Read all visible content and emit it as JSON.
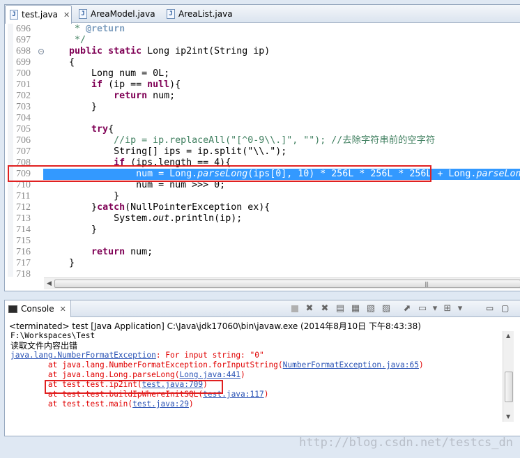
{
  "editor": {
    "tabs": [
      {
        "label": "test.java",
        "active": true,
        "close": "✕"
      },
      {
        "label": "AreaModel.java",
        "active": false
      },
      {
        "label": "AreaList.java",
        "active": false
      }
    ],
    "lines": [
      {
        "num": "696",
        "parts": [
          {
            "t": "     * ",
            "c": "cm"
          },
          {
            "t": "@return",
            "c": "ann"
          }
        ]
      },
      {
        "num": "697",
        "parts": [
          {
            "t": "     */",
            "c": "cm"
          }
        ]
      },
      {
        "num": "698",
        "fold": true,
        "parts": [
          {
            "t": "    "
          },
          {
            "t": "public static",
            "c": "kw"
          },
          {
            "t": " Long ip2int(String ip)"
          }
        ]
      },
      {
        "num": "699",
        "parts": [
          {
            "t": "    {"
          }
        ]
      },
      {
        "num": "700",
        "parts": [
          {
            "t": "        Long num = 0L;"
          }
        ]
      },
      {
        "num": "701",
        "parts": [
          {
            "t": "        "
          },
          {
            "t": "if",
            "c": "kw"
          },
          {
            "t": " (ip == "
          },
          {
            "t": "null",
            "c": "kw"
          },
          {
            "t": "){"
          }
        ]
      },
      {
        "num": "702",
        "parts": [
          {
            "t": "            "
          },
          {
            "t": "return",
            "c": "kw"
          },
          {
            "t": " num;"
          }
        ]
      },
      {
        "num": "703",
        "parts": [
          {
            "t": "        }"
          }
        ]
      },
      {
        "num": "704",
        "parts": []
      },
      {
        "num": "705",
        "parts": [
          {
            "t": "        "
          },
          {
            "t": "try",
            "c": "kw"
          },
          {
            "t": "{"
          }
        ]
      },
      {
        "num": "706",
        "parts": [
          {
            "t": "            //ip = ip.replaceAll(\"[^0-9\\\\.]\", \"\"); //去除字符串前的空字符",
            "c": "cm"
          }
        ]
      },
      {
        "num": "707",
        "parts": [
          {
            "t": "            String[] ips = ip.split(\"\\\\.\");"
          }
        ]
      },
      {
        "num": "708",
        "parts": [
          {
            "t": "            "
          },
          {
            "t": "if",
            "c": "kw"
          },
          {
            "t": " (ips.length == 4){"
          }
        ]
      },
      {
        "num": "709",
        "highlight": true,
        "parts": [
          {
            "t": "                num = Long."
          },
          {
            "t": "parseLong",
            "c": "it"
          },
          {
            "t": "(ips[0], 10) * 256L * 256L * 256L + Long."
          },
          {
            "t": "parseLong",
            "c": "it"
          }
        ]
      },
      {
        "num": "710",
        "parts": [
          {
            "t": "                num = num >>> 0;"
          }
        ]
      },
      {
        "num": "711",
        "parts": [
          {
            "t": "            }"
          }
        ]
      },
      {
        "num": "712",
        "parts": [
          {
            "t": "        }"
          },
          {
            "t": "catch",
            "c": "kw"
          },
          {
            "t": "(NullPointerException ex){"
          }
        ]
      },
      {
        "num": "713",
        "parts": [
          {
            "t": "            System."
          },
          {
            "t": "out",
            "c": "it"
          },
          {
            "t": ".println(ip);"
          }
        ]
      },
      {
        "num": "714",
        "parts": [
          {
            "t": "        }"
          }
        ]
      },
      {
        "num": "715",
        "parts": []
      },
      {
        "num": "716",
        "parts": [
          {
            "t": "        "
          },
          {
            "t": "return",
            "c": "kw"
          },
          {
            "t": " num;"
          }
        ]
      },
      {
        "num": "717",
        "parts": [
          {
            "t": "    }"
          }
        ]
      },
      {
        "num": "718",
        "parts": []
      }
    ],
    "hscroll_grip": "|||"
  },
  "console": {
    "tab_label": "Console",
    "tab_close": "✕",
    "terminated": "<terminated> test [Java Application] C:\\Java\\jdk17060\\bin\\javaw.exe (2014年8月10日 下午8:43:38)",
    "output": [
      {
        "cjk": false,
        "parts": [
          {
            "t": "F:\\Workspaces\\Test"
          }
        ]
      },
      {
        "cjk": true,
        "parts": [
          {
            "t": "读取文件内容出错"
          }
        ]
      },
      {
        "cjk": false,
        "parts": [
          {
            "t": "java.lang.NumberFormatException",
            "c": "lnk"
          },
          {
            "t": ": For input string: \"0\"",
            "c": "err"
          }
        ]
      },
      {
        "cjk": false,
        "parts": [
          {
            "t": "        at java.lang.NumberFormatException.forInputString(",
            "c": "err"
          },
          {
            "t": "NumberFormatException.java:65",
            "c": "lnk"
          },
          {
            "t": ")",
            "c": "err"
          }
        ]
      },
      {
        "cjk": false,
        "parts": [
          {
            "t": "        at java.lang.Long.parseLong(",
            "c": "err"
          },
          {
            "t": "Long.java:441",
            "c": "lnk"
          },
          {
            "t": ")",
            "c": "err"
          }
        ]
      },
      {
        "cjk": false,
        "parts": [
          {
            "t": "        at test.test.ip2int(",
            "c": "err"
          },
          {
            "t": "test.java:709",
            "c": "lnk"
          },
          {
            "t": ")",
            "c": "err"
          }
        ]
      },
      {
        "cjk": false,
        "parts": [
          {
            "t": "        at test.test.buildIpWhereInitSQL(",
            "c": "err"
          },
          {
            "t": "test.java:117",
            "c": "lnk"
          },
          {
            "t": ")",
            "c": "err"
          }
        ]
      },
      {
        "cjk": false,
        "parts": [
          {
            "t": "        at test.test.main(",
            "c": "err"
          },
          {
            "t": "test.java:29",
            "c": "lnk"
          },
          {
            "t": ")",
            "c": "err"
          }
        ]
      }
    ]
  },
  "watermark": "http://blog.csdn.net/testcs_dn",
  "colors": {
    "keyword": "#7f0055",
    "comment": "#3f7f5f",
    "error": "#e00000",
    "link": "#2a53b5",
    "selection": "#3399ff",
    "annotation_box": "#e02020"
  }
}
